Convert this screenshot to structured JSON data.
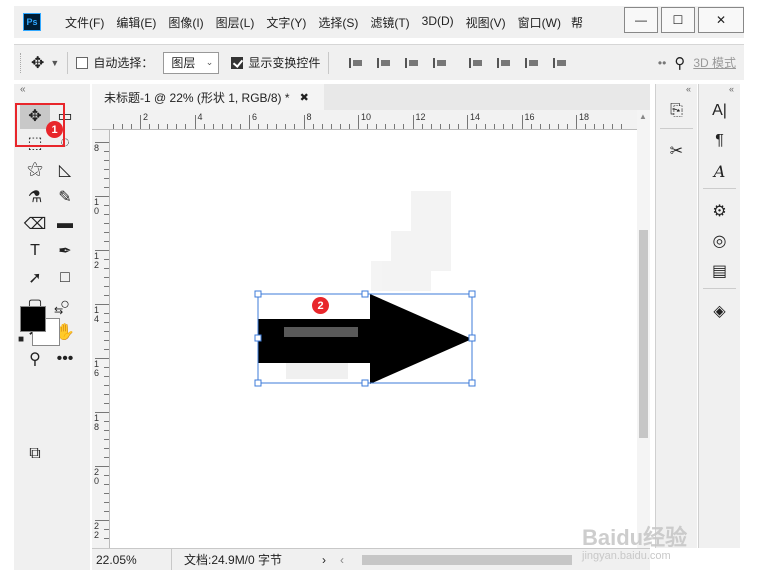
{
  "app": {
    "logo": "Ps"
  },
  "menu": {
    "items": [
      "文件(F)",
      "编辑(E)",
      "图像(I)",
      "图层(L)",
      "文字(Y)",
      "选择(S)",
      "滤镜(T)",
      "3D(D)",
      "视图(V)",
      "窗口(W)"
    ],
    "overflow": "帮"
  },
  "window_controls": {
    "minimize": "—",
    "maximize": "☐",
    "close": "✕"
  },
  "options": {
    "auto_select_label": "自动选择：",
    "auto_select_checked": false,
    "layer_select_value": "图层",
    "show_transform_label": "显示变换控件",
    "show_transform_checked": true,
    "mode_label": "3D 模式"
  },
  "document": {
    "tab_title": "未标题-1 @ 22% (形状 1, RGB/8) *",
    "close": "✖",
    "ruler_h_labels": [
      "2",
      "4",
      "6",
      "8",
      "10",
      "12",
      "14",
      "16",
      "18"
    ],
    "ruler_v_labels": [
      "8",
      "10",
      "12",
      "14",
      "16",
      "18",
      "20",
      "22"
    ]
  },
  "status": {
    "zoom": "22.05%",
    "doc_info": "文档:24.9M/0 字节",
    "nav_next": "›",
    "nav_prev": "‹"
  },
  "markers": {
    "one": "1",
    "two": "2"
  },
  "colors": {
    "foreground": "#000000",
    "background": "#ffffff",
    "highlight": "#e8262b",
    "selection": "#3d7bd9"
  },
  "watermark": {
    "brand": "Baidu经验",
    "url": "jingyan.baidu.com"
  }
}
